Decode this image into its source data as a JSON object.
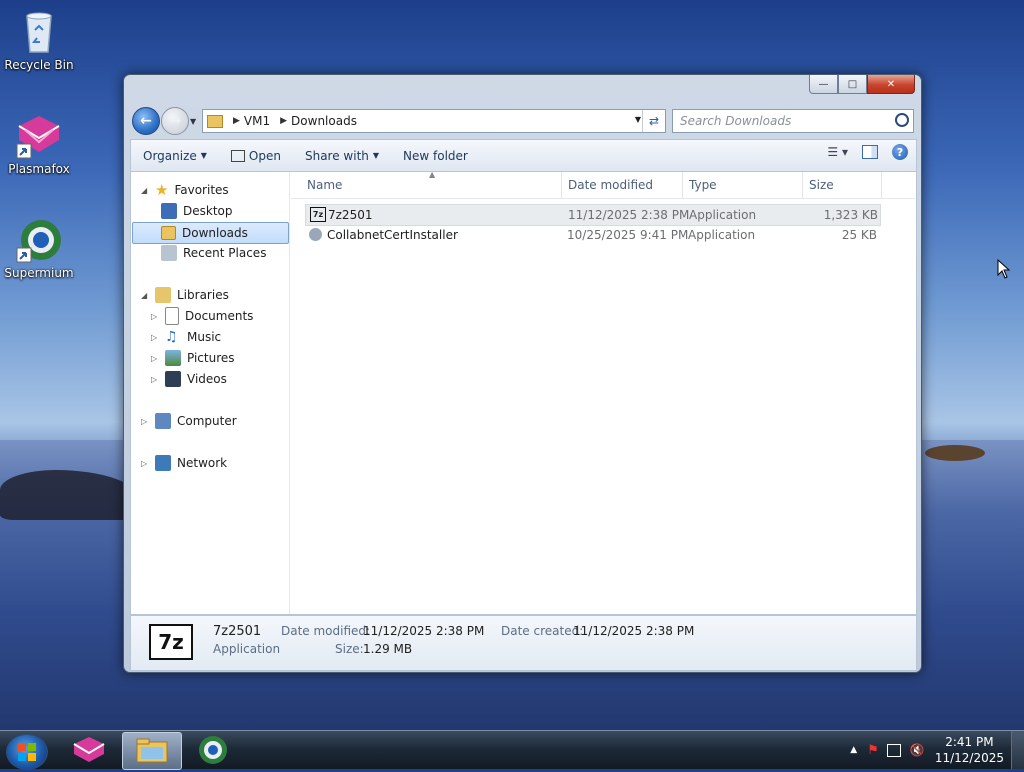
{
  "desktop": {
    "icons": [
      {
        "label": "Recycle Bin"
      },
      {
        "label": "Plasmafox"
      },
      {
        "label": "Supermium"
      }
    ]
  },
  "window": {
    "address": {
      "segments": [
        "VM1",
        "Downloads"
      ]
    },
    "search": {
      "placeholder": "Search Downloads"
    },
    "toolbar": {
      "organize": "Organize",
      "open": "Open",
      "share_with": "Share with",
      "new_folder": "New folder"
    },
    "nav": {
      "favorites": "Favorites",
      "desktop": "Desktop",
      "downloads": "Downloads",
      "recent_places": "Recent Places",
      "libraries": "Libraries",
      "documents": "Documents",
      "music": "Music",
      "pictures": "Pictures",
      "videos": "Videos",
      "computer": "Computer",
      "network": "Network"
    },
    "columns": {
      "name": "Name",
      "date_modified": "Date modified",
      "type": "Type",
      "size": "Size"
    },
    "files": [
      {
        "name": "7z2501",
        "date": "11/12/2025 2:38 PM",
        "type": "Application",
        "size": "1,323 KB"
      },
      {
        "name": "CollabnetCertInstaller",
        "date": "10/25/2025 9:41 PM",
        "type": "Application",
        "size": "25 KB"
      }
    ],
    "details": {
      "icon_text": "7z",
      "name": "7z2501",
      "type": "Application",
      "date_modified_label": "Date modified:",
      "date_modified": "11/12/2025 2:38 PM",
      "date_created_label": "Date created:",
      "date_created": "11/12/2025 2:38 PM",
      "size_label": "Size:",
      "size": "1.29 MB"
    }
  },
  "taskbar": {
    "time": "2:41 PM",
    "date": "11/12/2025"
  },
  "colors": {
    "selection": "#c1dcfc",
    "window_frame": "#bccadb",
    "taskbar": "#1e2a38"
  }
}
